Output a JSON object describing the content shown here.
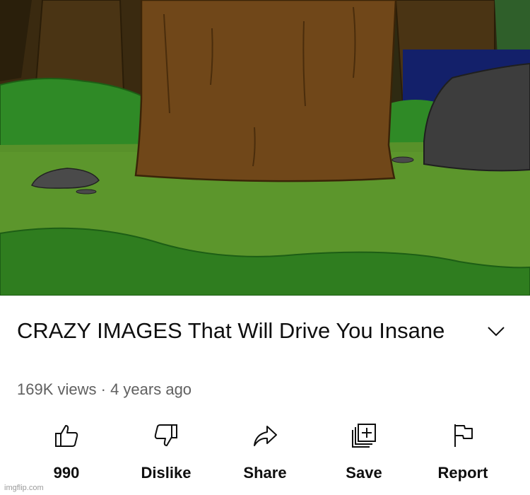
{
  "video": {
    "thumbnail": "cartoon forest scene with tree trunk and rocks"
  },
  "title": "CRAZY IMAGES That Will Drive You Insane",
  "meta": {
    "views": "169K views",
    "separator": " · ",
    "age": "4 years ago"
  },
  "actions": [
    {
      "label": "990",
      "icon": "thumbs-up-icon"
    },
    {
      "label": "Dislike",
      "icon": "thumbs-down-icon"
    },
    {
      "label": "Share",
      "icon": "share-icon"
    },
    {
      "label": "Save",
      "icon": "save-playlist-icon"
    },
    {
      "label": "Report",
      "icon": "flag-icon"
    }
  ],
  "watermark": "imgflip.com",
  "colors": {
    "grass": "#4f8f2a",
    "dark_grass": "#2f7a1c",
    "trunk": "#6b4518",
    "text_primary": "#0f0f0f",
    "text_secondary": "#606060"
  }
}
